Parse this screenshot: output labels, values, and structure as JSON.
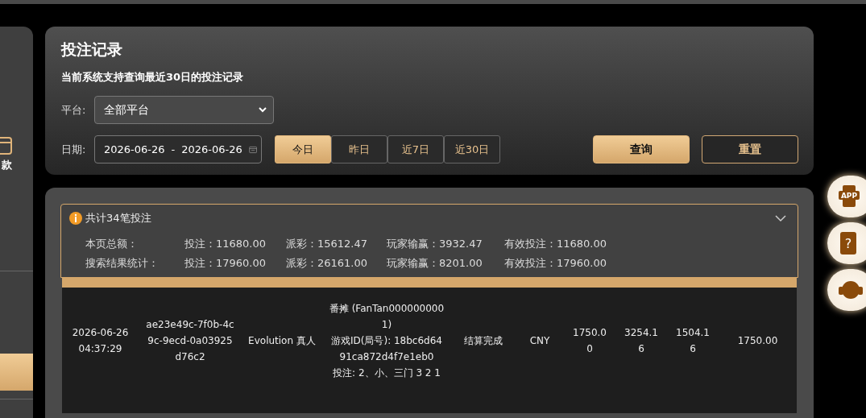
{
  "sidebar": {
    "label": "款"
  },
  "header": {
    "title": "投注记录",
    "subtitle": "当前系统支持查询最近30日的投注记录"
  },
  "filters": {
    "platform_label": "平台:",
    "platform_value": "全部平台",
    "date_label": "日期:",
    "date_start": "2026-06-26",
    "date_separator": "-",
    "date_end": "2026-06-26"
  },
  "quick_ranges": [
    {
      "label": "今日",
      "selected": true
    },
    {
      "label": "昨日",
      "selected": false
    },
    {
      "label": "近7日",
      "selected": false
    },
    {
      "label": "近30日",
      "selected": false
    }
  ],
  "actions": [
    {
      "label": "查询",
      "kind": "primary"
    },
    {
      "label": "重置",
      "kind": "secondary"
    }
  ],
  "summary": {
    "title": "共计34笔投注",
    "expanded": true,
    "rows": [
      {
        "label": "本页总额：",
        "items": [
          "投注：11680.00",
          "派彩：15612.47",
          "玩家输赢：3932.47",
          "有效投注：11680.00"
        ]
      },
      {
        "label": "搜索结果统计：",
        "items": [
          "投注：17960.00",
          "派彩：26161.00",
          "玩家输赢：8201.00",
          "有效投注：17960.00"
        ]
      }
    ]
  },
  "table": {
    "rows": [
      {
        "cells": [
          "2026-06-26 04:37:29",
          "ae23e49c-7f0b-4c9c-9ecd-0a03925d76c2",
          "Evolution 真人",
          [
            "番摊 (FanTan0000000001)",
            "游戏ID(局号): 18bc6d6491ca872d4f7e1eb0",
            "投注: 2、小、三门 3 2 1"
          ],
          "结算完成",
          "CNY",
          "1750.00",
          "3254.16",
          "1504.16",
          "1750.00"
        ]
      }
    ]
  },
  "side_buttons": [
    {
      "kind": "app",
      "label": "APP"
    },
    {
      "kind": "help",
      "label": "?"
    },
    {
      "kind": "support"
    }
  ]
}
